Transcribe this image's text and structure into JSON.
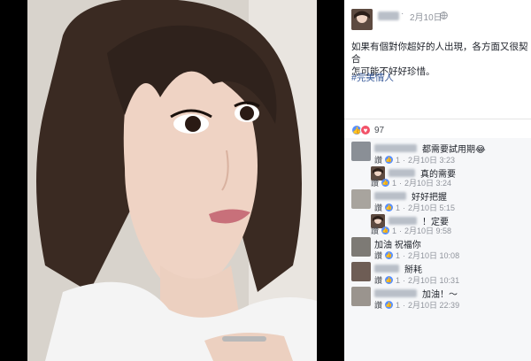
{
  "post": {
    "date": "2月10日",
    "text_line1": "如果有個對你超好的人出現，各方面又很契合",
    "text_line2": "怎可能不好好珍惜。",
    "hashtag": "#完美情人",
    "reaction_count": "97"
  },
  "comments": [
    {
      "text": "都需要試用期😂",
      "like_label": "讚",
      "like_count": "1",
      "date": "2月10日 3:23",
      "reply": {
        "text": "真的需要",
        "like_label": "讚",
        "like_count": "1",
        "date": "2月10日 3:24"
      }
    },
    {
      "text": "好好把握",
      "like_label": "讚",
      "like_count": "1",
      "date": "2月10日 5:15",
      "reply": {
        "text": "！定要",
        "like_label": "讚",
        "like_count": "1",
        "date": "2月10日 9:58"
      }
    },
    {
      "text": "加油 祝福你",
      "like_label": "讚",
      "like_count": "1",
      "date": "2月10日 10:08"
    },
    {
      "text": "掰耗",
      "like_label": "讚",
      "like_count": "1",
      "date": "2月10日 10:31"
    },
    {
      "text": "加油！～",
      "like_label": "讚",
      "like_count": "1",
      "date": "2月10日 22:39"
    }
  ],
  "colors": {
    "link": "#365899",
    "meta": "#90949c",
    "like_blue": "#5890ff",
    "love_red": "#f25268"
  },
  "icons": {
    "globe": "globe-icon",
    "like": "like-icon",
    "love": "love-icon"
  }
}
